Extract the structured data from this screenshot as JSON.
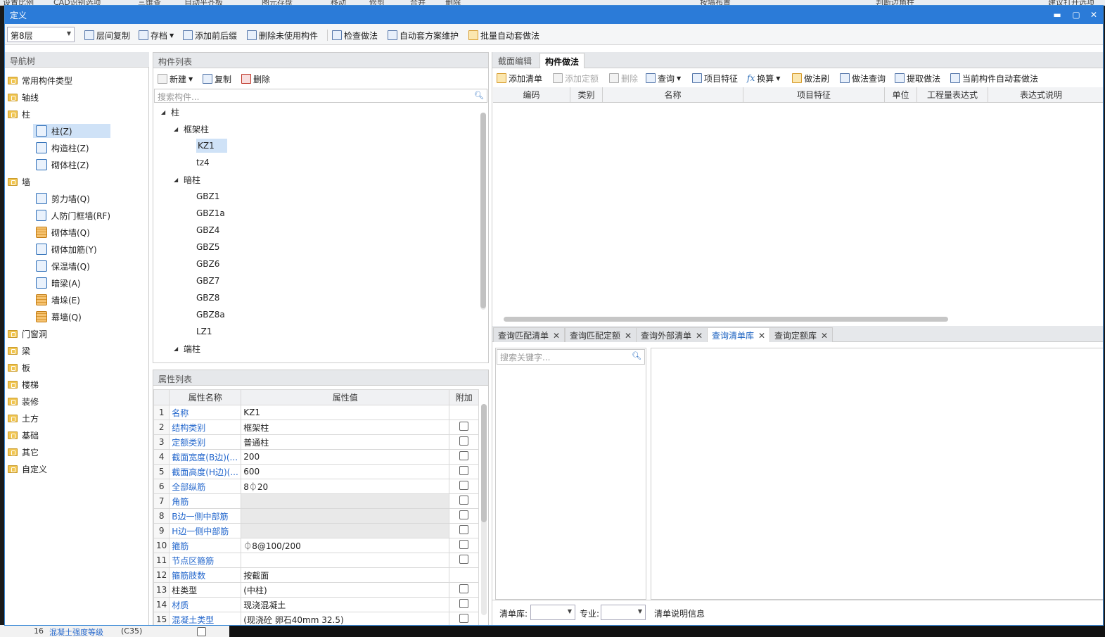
{
  "background": {
    "top_items": [
      "设置比例",
      "CAD识别选项",
      "三维查",
      "自动平齐板",
      "图元存盘",
      "移动",
      "修剪",
      "合并",
      "删除",
      "按墙布置",
      "判断边角柱",
      "建议打开选项"
    ],
    "bottom_row": {
      "num": "16",
      "name": "混凝土强度等级",
      "value": "(C35)"
    }
  },
  "window": {
    "title": "定义",
    "minimize": "▬",
    "maximize": "▢",
    "close": "✕"
  },
  "toolbar": {
    "floor": "第8层",
    "items": [
      "层间复制",
      "存档",
      "添加前后缀",
      "删除未使用构件",
      "检查做法",
      "自动套方案维护",
      "批量自动套做法"
    ]
  },
  "nav": {
    "title": "导航树",
    "items": [
      {
        "label": "常用构件类型",
        "level": 0
      },
      {
        "label": "轴线",
        "level": 0
      },
      {
        "label": "柱",
        "level": 0,
        "open": true
      },
      {
        "label": "柱(Z)",
        "level": 1,
        "selected": true,
        "icon": "column-icon"
      },
      {
        "label": "构造柱(Z)",
        "level": 1,
        "icon": "constructional-column-icon"
      },
      {
        "label": "砌体柱(Z)",
        "level": 1,
        "icon": "masonry-column-icon"
      },
      {
        "label": "墙",
        "level": 0,
        "open": true
      },
      {
        "label": "剪力墙(Q)",
        "level": 1,
        "icon": "shear-wall-icon"
      },
      {
        "label": "人防门框墙(RF)",
        "level": 1,
        "icon": "civil-defense-door-wall-icon"
      },
      {
        "label": "砌体墙(Q)",
        "level": 1,
        "icon": "masonry-wall-icon"
      },
      {
        "label": "砌体加筋(Y)",
        "level": 1,
        "icon": "masonry-rebar-icon"
      },
      {
        "label": "保温墙(Q)",
        "level": 1,
        "icon": "insulation-wall-icon"
      },
      {
        "label": "暗梁(A)",
        "level": 1,
        "icon": "hidden-beam-icon"
      },
      {
        "label": "墙垛(E)",
        "level": 1,
        "icon": "wall-pier-icon"
      },
      {
        "label": "幕墙(Q)",
        "level": 1,
        "icon": "curtain-wall-icon"
      },
      {
        "label": "门窗洞",
        "level": 0
      },
      {
        "label": "梁",
        "level": 0
      },
      {
        "label": "板",
        "level": 0
      },
      {
        "label": "楼梯",
        "level": 0
      },
      {
        "label": "装修",
        "level": 0
      },
      {
        "label": "土方",
        "level": 0
      },
      {
        "label": "基础",
        "level": 0
      },
      {
        "label": "其它",
        "level": 0
      },
      {
        "label": "自定义",
        "level": 0
      }
    ]
  },
  "component_list": {
    "title": "构件列表",
    "actions": [
      "新建",
      "复制",
      "删除"
    ],
    "search_placeholder": "搜索构件...",
    "tree": [
      {
        "label": "柱",
        "level": 0,
        "group": true
      },
      {
        "label": "框架柱",
        "level": 1,
        "group": true
      },
      {
        "label": "KZ1",
        "level": 2,
        "selected": true
      },
      {
        "label": "tz4",
        "level": 2
      },
      {
        "label": "暗柱",
        "level": 1,
        "group": true
      },
      {
        "label": "GBZ1",
        "level": 2
      },
      {
        "label": "GBZ1a",
        "level": 2
      },
      {
        "label": "GBZ4",
        "level": 2
      },
      {
        "label": "GBZ5",
        "level": 2
      },
      {
        "label": "GBZ6",
        "level": 2
      },
      {
        "label": "GBZ7",
        "level": 2
      },
      {
        "label": "GBZ8",
        "level": 2
      },
      {
        "label": "GBZ8a",
        "level": 2
      },
      {
        "label": "LZ1",
        "level": 2
      },
      {
        "label": "端柱",
        "level": 1,
        "group": true
      }
    ]
  },
  "properties": {
    "title": "属性列表",
    "headers": [
      "属性名称",
      "属性值",
      "附加"
    ],
    "rows": [
      {
        "num": "1",
        "name": "名称",
        "value": "KZ1",
        "check": false,
        "blue": true
      },
      {
        "num": "2",
        "name": "结构类别",
        "value": "框架柱",
        "check": true,
        "blue": true
      },
      {
        "num": "3",
        "name": "定额类别",
        "value": "普通柱",
        "check": true,
        "blue": true
      },
      {
        "num": "4",
        "name": "截面宽度(B边)(...",
        "value": "200",
        "check": true,
        "blue": true
      },
      {
        "num": "5",
        "name": "截面高度(H边)(...",
        "value": "600",
        "check": true,
        "blue": true
      },
      {
        "num": "6",
        "name": "全部纵筋",
        "value": "8⏀20",
        "check": true,
        "blue": true
      },
      {
        "num": "7",
        "name": "角筋",
        "value": "",
        "check": true,
        "blue": true,
        "gray": true
      },
      {
        "num": "8",
        "name": "B边一侧中部筋",
        "value": "",
        "check": true,
        "blue": true,
        "gray": true
      },
      {
        "num": "9",
        "name": "H边一侧中部筋",
        "value": "",
        "check": true,
        "blue": true,
        "gray": true
      },
      {
        "num": "10",
        "name": "箍筋",
        "value": "⏀8@100/200",
        "check": true,
        "blue": true
      },
      {
        "num": "11",
        "name": "节点区箍筋",
        "value": "",
        "check": true,
        "blue": true
      },
      {
        "num": "12",
        "name": "箍筋肢数",
        "value": "按截面",
        "check": false,
        "blue": true
      },
      {
        "num": "13",
        "name": "柱类型",
        "value": "(中柱)",
        "check": true,
        "blue": false
      },
      {
        "num": "14",
        "name": "材质",
        "value": "现浇混凝土",
        "check": true,
        "blue": true
      },
      {
        "num": "15",
        "name": "混凝土类型",
        "value": "(现浇砼 卵石40mm 32.5)",
        "check": true,
        "blue": true
      }
    ]
  },
  "method_panel": {
    "tabs": [
      "截面编辑",
      "构件做法"
    ],
    "active_tab": "构件做法",
    "actions": [
      "添加清单",
      "添加定额",
      "删除",
      "查询",
      "项目特征",
      "换算",
      "做法刷",
      "做法查询",
      "提取做法",
      "当前构件自动套做法"
    ],
    "columns": [
      "编码",
      "类别",
      "名称",
      "项目特征",
      "单位",
      "工程量表达式",
      "表达式说明"
    ]
  },
  "query_panel": {
    "tabs": [
      "查询匹配清单",
      "查询匹配定额",
      "查询外部清单",
      "查询清单库",
      "查询定额库"
    ],
    "active_tab": "查询清单库",
    "search_placeholder": "搜索关键字...",
    "footer": {
      "list_label": "清单库:",
      "major_label": "专业:",
      "info_label": "清单说明信息"
    }
  }
}
